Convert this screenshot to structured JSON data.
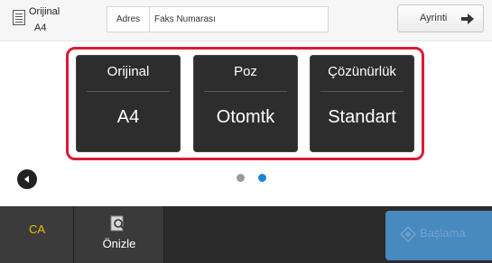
{
  "header": {
    "original_label": "Orijinal",
    "original_size": "A4",
    "address_label": "Adres",
    "fax_placeholder": "Faks Numarası",
    "detail_label": "Ayrinti"
  },
  "tiles": [
    {
      "title": "Orijinal",
      "value": "A4"
    },
    {
      "title": "Poz",
      "value": "Otomtk"
    },
    {
      "title": "Çözünürlük",
      "value": "Standart"
    }
  ],
  "pager": {
    "current_page": 2,
    "total_pages": 2
  },
  "footer": {
    "ca_label": "CA",
    "preview_label": "Önizle",
    "start_label": "Başlama"
  },
  "colors": {
    "accent_frame": "#d71d36",
    "start_button": "#4a8fc9",
    "dot_active": "#1e82d9",
    "dot_inactive": "#9a9a9a"
  }
}
